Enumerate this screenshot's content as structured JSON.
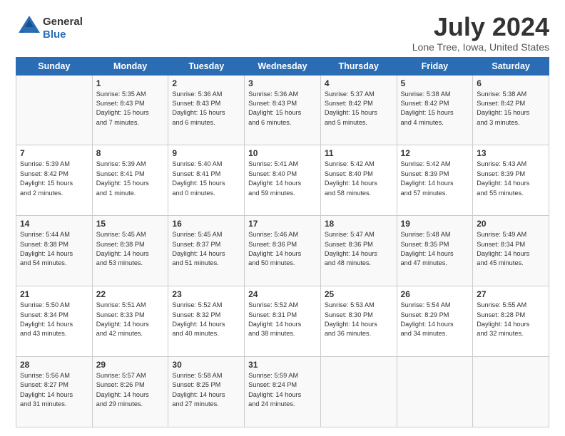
{
  "header": {
    "logo_general": "General",
    "logo_blue": "Blue",
    "month_title": "July 2024",
    "location": "Lone Tree, Iowa, United States"
  },
  "days_of_week": [
    "Sunday",
    "Monday",
    "Tuesday",
    "Wednesday",
    "Thursday",
    "Friday",
    "Saturday"
  ],
  "weeks": [
    [
      {
        "day": "",
        "info": ""
      },
      {
        "day": "1",
        "info": "Sunrise: 5:35 AM\nSunset: 8:43 PM\nDaylight: 15 hours\nand 7 minutes."
      },
      {
        "day": "2",
        "info": "Sunrise: 5:36 AM\nSunset: 8:43 PM\nDaylight: 15 hours\nand 6 minutes."
      },
      {
        "day": "3",
        "info": "Sunrise: 5:36 AM\nSunset: 8:43 PM\nDaylight: 15 hours\nand 6 minutes."
      },
      {
        "day": "4",
        "info": "Sunrise: 5:37 AM\nSunset: 8:42 PM\nDaylight: 15 hours\nand 5 minutes."
      },
      {
        "day": "5",
        "info": "Sunrise: 5:38 AM\nSunset: 8:42 PM\nDaylight: 15 hours\nand 4 minutes."
      },
      {
        "day": "6",
        "info": "Sunrise: 5:38 AM\nSunset: 8:42 PM\nDaylight: 15 hours\nand 3 minutes."
      }
    ],
    [
      {
        "day": "7",
        "info": "Sunrise: 5:39 AM\nSunset: 8:42 PM\nDaylight: 15 hours\nand 2 minutes."
      },
      {
        "day": "8",
        "info": "Sunrise: 5:39 AM\nSunset: 8:41 PM\nDaylight: 15 hours\nand 1 minute."
      },
      {
        "day": "9",
        "info": "Sunrise: 5:40 AM\nSunset: 8:41 PM\nDaylight: 15 hours\nand 0 minutes."
      },
      {
        "day": "10",
        "info": "Sunrise: 5:41 AM\nSunset: 8:40 PM\nDaylight: 14 hours\nand 59 minutes."
      },
      {
        "day": "11",
        "info": "Sunrise: 5:42 AM\nSunset: 8:40 PM\nDaylight: 14 hours\nand 58 minutes."
      },
      {
        "day": "12",
        "info": "Sunrise: 5:42 AM\nSunset: 8:39 PM\nDaylight: 14 hours\nand 57 minutes."
      },
      {
        "day": "13",
        "info": "Sunrise: 5:43 AM\nSunset: 8:39 PM\nDaylight: 14 hours\nand 55 minutes."
      }
    ],
    [
      {
        "day": "14",
        "info": "Sunrise: 5:44 AM\nSunset: 8:38 PM\nDaylight: 14 hours\nand 54 minutes."
      },
      {
        "day": "15",
        "info": "Sunrise: 5:45 AM\nSunset: 8:38 PM\nDaylight: 14 hours\nand 53 minutes."
      },
      {
        "day": "16",
        "info": "Sunrise: 5:45 AM\nSunset: 8:37 PM\nDaylight: 14 hours\nand 51 minutes."
      },
      {
        "day": "17",
        "info": "Sunrise: 5:46 AM\nSunset: 8:36 PM\nDaylight: 14 hours\nand 50 minutes."
      },
      {
        "day": "18",
        "info": "Sunrise: 5:47 AM\nSunset: 8:36 PM\nDaylight: 14 hours\nand 48 minutes."
      },
      {
        "day": "19",
        "info": "Sunrise: 5:48 AM\nSunset: 8:35 PM\nDaylight: 14 hours\nand 47 minutes."
      },
      {
        "day": "20",
        "info": "Sunrise: 5:49 AM\nSunset: 8:34 PM\nDaylight: 14 hours\nand 45 minutes."
      }
    ],
    [
      {
        "day": "21",
        "info": "Sunrise: 5:50 AM\nSunset: 8:34 PM\nDaylight: 14 hours\nand 43 minutes."
      },
      {
        "day": "22",
        "info": "Sunrise: 5:51 AM\nSunset: 8:33 PM\nDaylight: 14 hours\nand 42 minutes."
      },
      {
        "day": "23",
        "info": "Sunrise: 5:52 AM\nSunset: 8:32 PM\nDaylight: 14 hours\nand 40 minutes."
      },
      {
        "day": "24",
        "info": "Sunrise: 5:52 AM\nSunset: 8:31 PM\nDaylight: 14 hours\nand 38 minutes."
      },
      {
        "day": "25",
        "info": "Sunrise: 5:53 AM\nSunset: 8:30 PM\nDaylight: 14 hours\nand 36 minutes."
      },
      {
        "day": "26",
        "info": "Sunrise: 5:54 AM\nSunset: 8:29 PM\nDaylight: 14 hours\nand 34 minutes."
      },
      {
        "day": "27",
        "info": "Sunrise: 5:55 AM\nSunset: 8:28 PM\nDaylight: 14 hours\nand 32 minutes."
      }
    ],
    [
      {
        "day": "28",
        "info": "Sunrise: 5:56 AM\nSunset: 8:27 PM\nDaylight: 14 hours\nand 31 minutes."
      },
      {
        "day": "29",
        "info": "Sunrise: 5:57 AM\nSunset: 8:26 PM\nDaylight: 14 hours\nand 29 minutes."
      },
      {
        "day": "30",
        "info": "Sunrise: 5:58 AM\nSunset: 8:25 PM\nDaylight: 14 hours\nand 27 minutes."
      },
      {
        "day": "31",
        "info": "Sunrise: 5:59 AM\nSunset: 8:24 PM\nDaylight: 14 hours\nand 24 minutes."
      },
      {
        "day": "",
        "info": ""
      },
      {
        "day": "",
        "info": ""
      },
      {
        "day": "",
        "info": ""
      }
    ]
  ]
}
